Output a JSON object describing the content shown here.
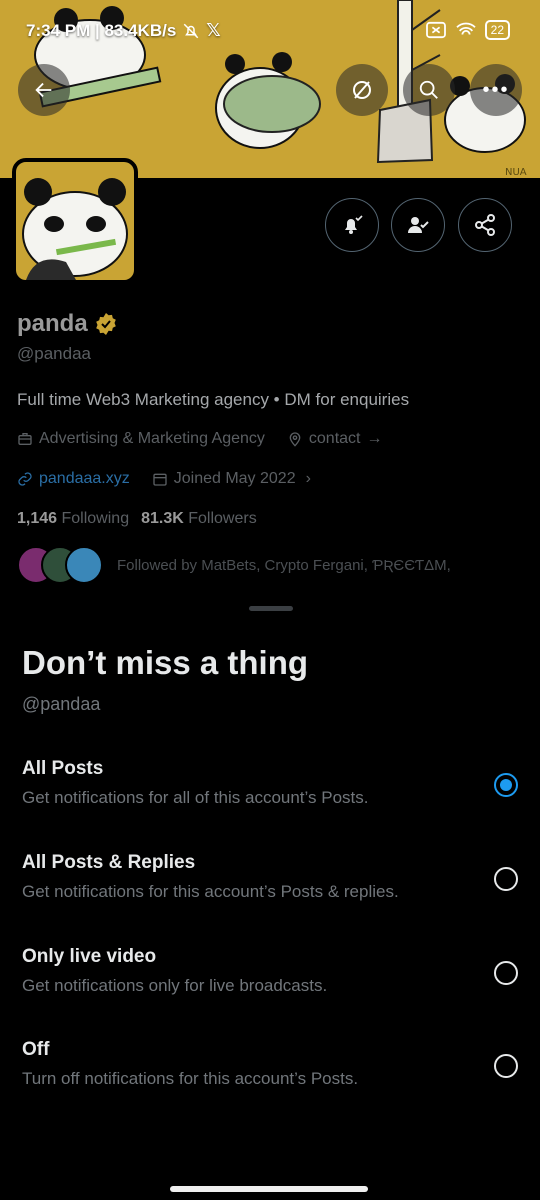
{
  "status_bar": {
    "time_speed": "7:34 PM | 83.4KB/s",
    "battery": "22",
    "icons": [
      "bell-off-icon",
      "x-logo-icon",
      "sim-icon",
      "wifi-icon",
      "battery-icon"
    ]
  },
  "banner": {
    "signature": "NUA",
    "description_colors": {
      "background": "#c9a434"
    }
  },
  "header_buttons": [
    "back-arrow-icon",
    "grok-icon",
    "search-icon",
    "more-icon"
  ],
  "profile": {
    "name": "panda",
    "handle": "@pandaa",
    "bio": "Full time Web3 Marketing agency • DM for enquiries",
    "category": "Advertising & Marketing Agency",
    "location": "contact",
    "website": "pandaaa.xyz",
    "joined": "Joined May 2022",
    "following_count": "1,146",
    "following_label": "Following",
    "followers_count": "81.3K",
    "followers_label": "Followers",
    "followed_by": "Followed by MatBets, Crypto Fergani, ƤƦЄЄƬΔM,",
    "verified_color": "#c9a434"
  },
  "sheet": {
    "title": "Don’t miss a thing",
    "handle": "@pandaa",
    "options": [
      {
        "label": "All Posts",
        "desc": "Get notifications for all of this account’s Posts.",
        "selected": true
      },
      {
        "label": "All Posts & Replies",
        "desc": "Get notifications for this account’s Posts & replies.",
        "selected": false
      },
      {
        "label": "Only live video",
        "desc": "Get notifications only for live broadcasts.",
        "selected": false
      },
      {
        "label": "Off",
        "desc": "Turn off notifications for this account’s Posts.",
        "selected": false
      }
    ],
    "accent_color": "#1d9bf0"
  }
}
